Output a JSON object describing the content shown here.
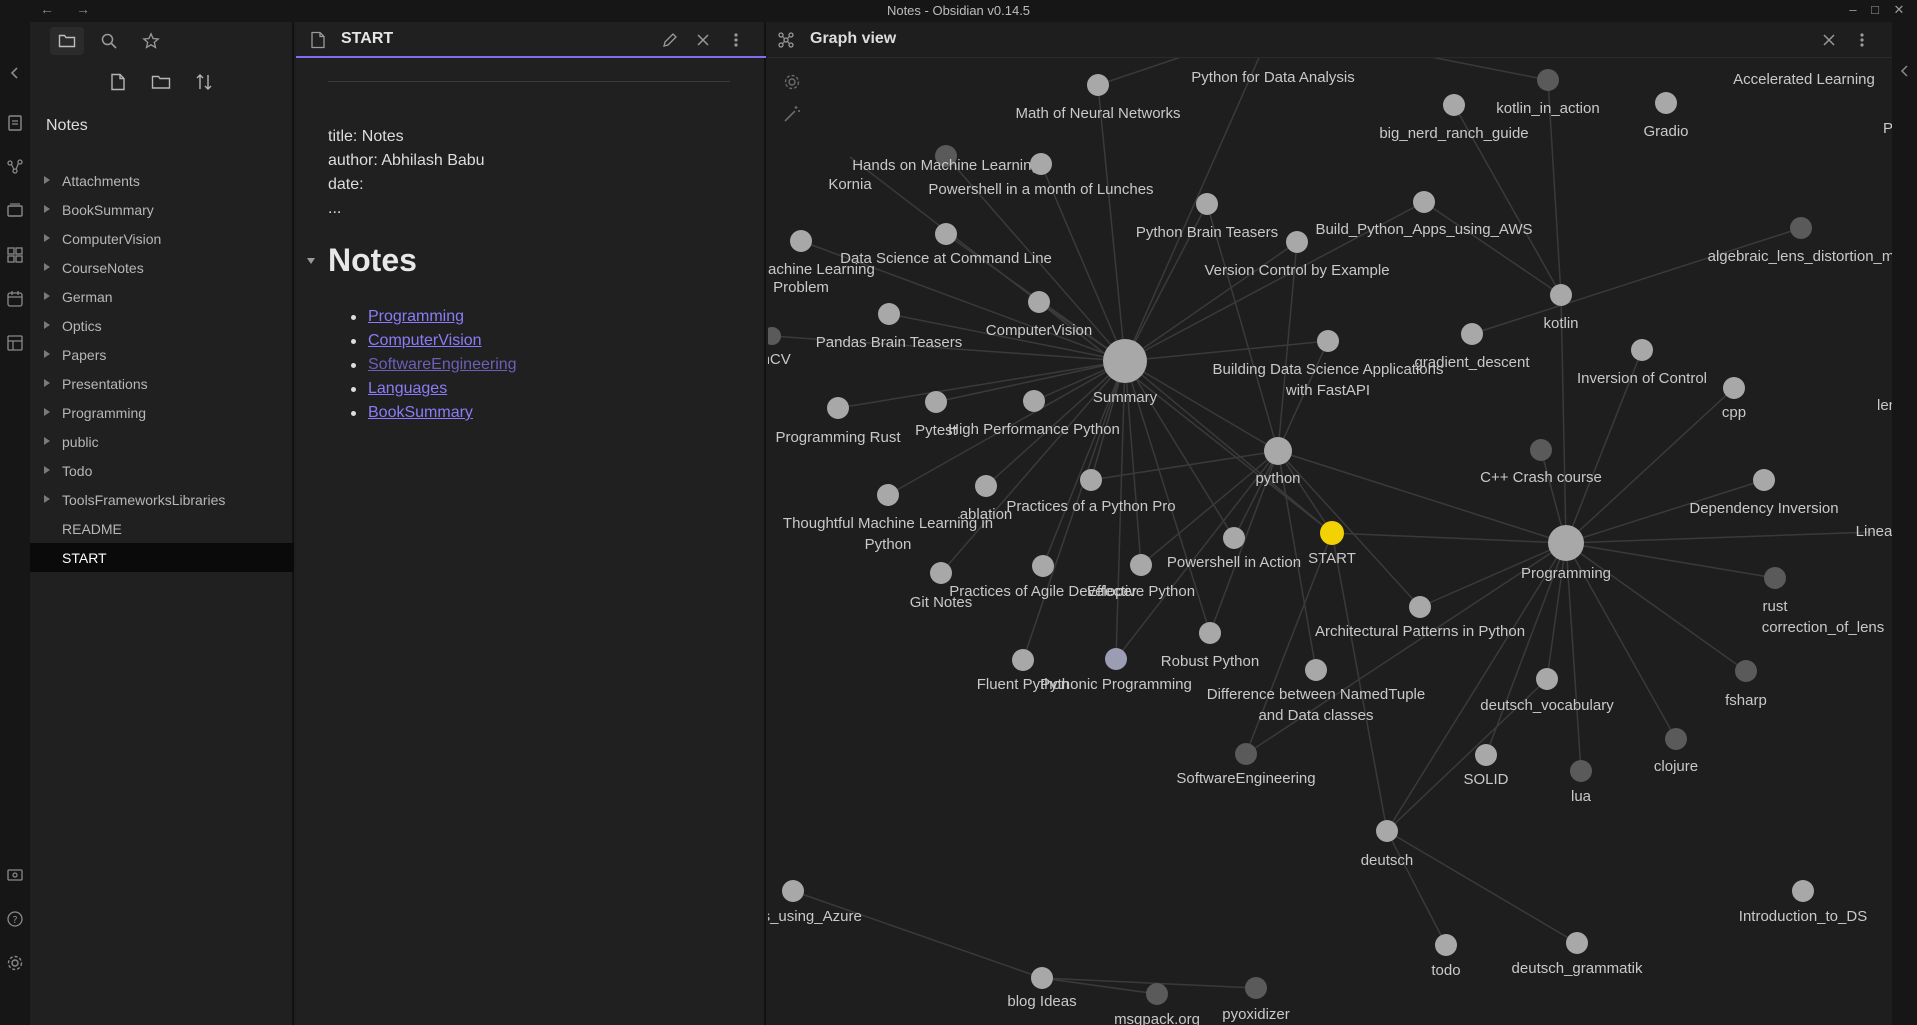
{
  "window": {
    "title": "Notes - Obsidian v0.14.5"
  },
  "sidebar": {
    "vault_name": "Notes",
    "tree": [
      {
        "label": "Attachments",
        "type": "folder"
      },
      {
        "label": "BookSummary",
        "type": "folder"
      },
      {
        "label": "ComputerVision",
        "type": "folder"
      },
      {
        "label": "CourseNotes",
        "type": "folder"
      },
      {
        "label": "German",
        "type": "folder"
      },
      {
        "label": "Optics",
        "type": "folder"
      },
      {
        "label": "Papers",
        "type": "folder"
      },
      {
        "label": "Presentations",
        "type": "folder"
      },
      {
        "label": "Programming",
        "type": "folder"
      },
      {
        "label": "public",
        "type": "folder"
      },
      {
        "label": "Todo",
        "type": "folder"
      },
      {
        "label": "ToolsFrameworksLibraries",
        "type": "folder"
      },
      {
        "label": "README",
        "type": "file"
      },
      {
        "label": "START",
        "type": "file",
        "selected": true
      }
    ]
  },
  "editor": {
    "tab_title": "START",
    "frontmatter": {
      "title_line": "title: Notes",
      "author_line": "author: Abhilash Babu",
      "date_line": "date:",
      "ellipsis": "..."
    },
    "heading": "Notes",
    "links": [
      {
        "label": "Programming",
        "resolved": true
      },
      {
        "label": "ComputerVision",
        "resolved": true
      },
      {
        "label": "SoftwareEngineering",
        "resolved": false
      },
      {
        "label": "Languages",
        "resolved": true
      },
      {
        "label": "BookSummary",
        "resolved": true
      }
    ]
  },
  "graph": {
    "title": "Graph view",
    "colors": {
      "node": "#a8a8a8",
      "node_dim": "#5a5a5a",
      "node_active": "#f2d205",
      "edge": "#3a3a3a",
      "accent": "#7f6df2"
    },
    "nodes": [
      {
        "id": "summary",
        "label": "Summary"
      },
      {
        "id": "python",
        "label": "python"
      },
      {
        "id": "programming",
        "label": "Programming"
      },
      {
        "id": "start",
        "label": "START"
      },
      {
        "id": "deutsch",
        "label": "deutsch"
      },
      {
        "id": "kotlin",
        "label": "kotlin"
      },
      {
        "id": "math_nn",
        "label": "Math of Neural Networks"
      },
      {
        "id": "py_data",
        "label": "Python for Data Analysis"
      },
      {
        "id": "kotlin_action",
        "label": "kotlin_in_action"
      },
      {
        "id": "big_nerd",
        "label": "big_nerd_ranch_guide"
      },
      {
        "id": "gradio",
        "label": "Gradio"
      },
      {
        "id": "accel",
        "label": "Accelerated Learning"
      },
      {
        "id": "hands_on",
        "label": "Hands on Machine Learning"
      },
      {
        "id": "kornia",
        "label": "Kornia"
      },
      {
        "id": "powershell_lunch",
        "label": "Powershell in a month of Lunches"
      },
      {
        "id": "py_brain",
        "label": "Python Brain Teasers"
      },
      {
        "id": "build_aws",
        "label": "Build_Python_Apps_using_AWS"
      },
      {
        "id": "algebraic",
        "label": "algebraic_lens_distortion_m"
      },
      {
        "id": "many_ml",
        "label": "any Machine Learning"
      },
      {
        "id": "problem",
        "label": "Problem"
      },
      {
        "id": "ds_cmd",
        "label": "Data Science at Command Line"
      },
      {
        "id": "vc_example",
        "label": "Version Control by Example"
      },
      {
        "id": "computervision",
        "label": "ComputerVision"
      },
      {
        "id": "pandas_brain",
        "label": "Pandas Brain Teasers"
      },
      {
        "id": "encv",
        "label": "enCV"
      },
      {
        "id": "fastapi",
        "label": "Building Data Science Applications"
      },
      {
        "id": "fastapi2",
        "label": "with FastAPI"
      },
      {
        "id": "gradient",
        "label": "gradient_descent"
      },
      {
        "id": "ioc",
        "label": "Inversion of Control"
      },
      {
        "id": "cpp",
        "label": "cpp"
      },
      {
        "id": "len",
        "label": "len"
      },
      {
        "id": "prog_rust",
        "label": "Programming Rust"
      },
      {
        "id": "pytest",
        "label": "Pytest"
      },
      {
        "id": "high_perf",
        "label": "High Performance Python"
      },
      {
        "id": "cpp_crash",
        "label": "C++ Crash course"
      },
      {
        "id": "thoughtful",
        "label": "Thoughtful Machine Learning in"
      },
      {
        "id": "thoughtful2",
        "label": "Python"
      },
      {
        "id": "ablation",
        "label": "ablation"
      },
      {
        "id": "practices_pro",
        "label": "Practices of a Python Pro"
      },
      {
        "id": "dep_inv",
        "label": "Dependency Inversion"
      },
      {
        "id": "linea",
        "label": "Linea"
      },
      {
        "id": "powershell_action",
        "label": "Powershell in Action"
      },
      {
        "id": "git_notes",
        "label": "Git Notes"
      },
      {
        "id": "agile",
        "label": "Practices of Agile Developer"
      },
      {
        "id": "effective",
        "label": "Effective Python"
      },
      {
        "id": "rust",
        "label": "rust"
      },
      {
        "id": "correction",
        "label": "correction_of_lens"
      },
      {
        "id": "arch_patterns",
        "label": "Architectural Patterns in Python"
      },
      {
        "id": "robust",
        "label": "Robust Python"
      },
      {
        "id": "fluent",
        "label": "Fluent Python"
      },
      {
        "id": "pythonic",
        "label": "Pythonic Programming"
      },
      {
        "id": "namedtuple",
        "label": "Difference between NamedTuple"
      },
      {
        "id": "namedtuple2",
        "label": "and Data classes"
      },
      {
        "id": "deutsch_vocab",
        "label": "deutsch_vocabulary"
      },
      {
        "id": "fsharp",
        "label": "fsharp"
      },
      {
        "id": "swe",
        "label": "SoftwareEngineering"
      },
      {
        "id": "solid",
        "label": "SOLID"
      },
      {
        "id": "lua",
        "label": "lua"
      },
      {
        "id": "clojure",
        "label": "clojure"
      },
      {
        "id": "azure",
        "label": "l_Apps_using_Azure"
      },
      {
        "id": "intro_ds",
        "label": "Introduction_to_DS"
      },
      {
        "id": "todo",
        "label": "todo"
      },
      {
        "id": "deutsch_gram",
        "label": "deutsch_grammatik"
      },
      {
        "id": "blog",
        "label": "blog Ideas"
      },
      {
        "id": "msgpack",
        "label": "msgpack.org"
      },
      {
        "id": "pyoxidizer",
        "label": "pyoxidizer"
      },
      {
        "id": "p_edge",
        "label": "P"
      }
    ]
  }
}
